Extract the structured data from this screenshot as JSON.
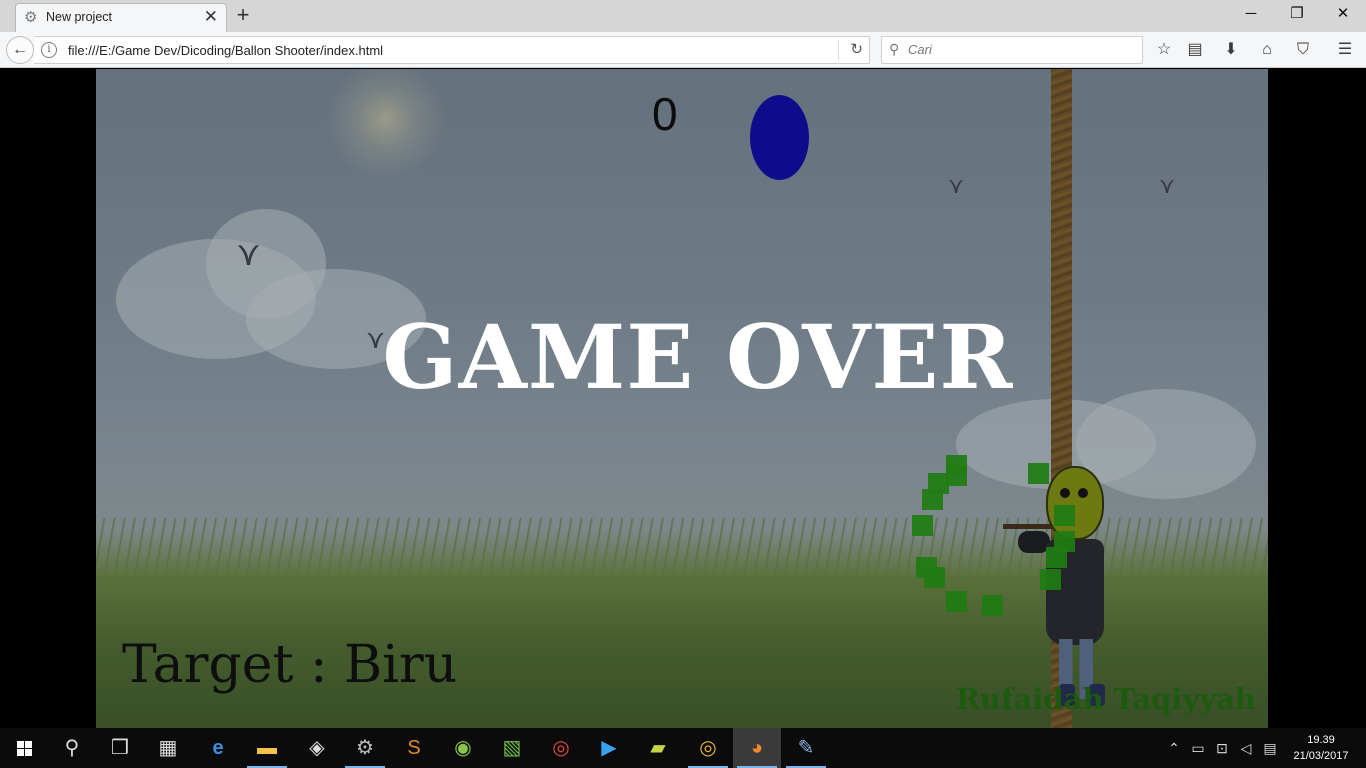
{
  "browser": {
    "tab_title": "New project",
    "tab_icon": "gear-icon",
    "url": "file:///E:/Game Dev/Dicoding/Ballon Shooter/index.html",
    "search_placeholder": "Cari"
  },
  "game": {
    "score": "0",
    "status": "GAME OVER",
    "target_text": "Target : Biru",
    "credit": "Rufaidah Taqiyyah",
    "balloon_color": "#0d0d8c",
    "particle_color": "#1f7c12"
  },
  "taskbar": {
    "time": "19.39",
    "date": "21/03/2017"
  }
}
